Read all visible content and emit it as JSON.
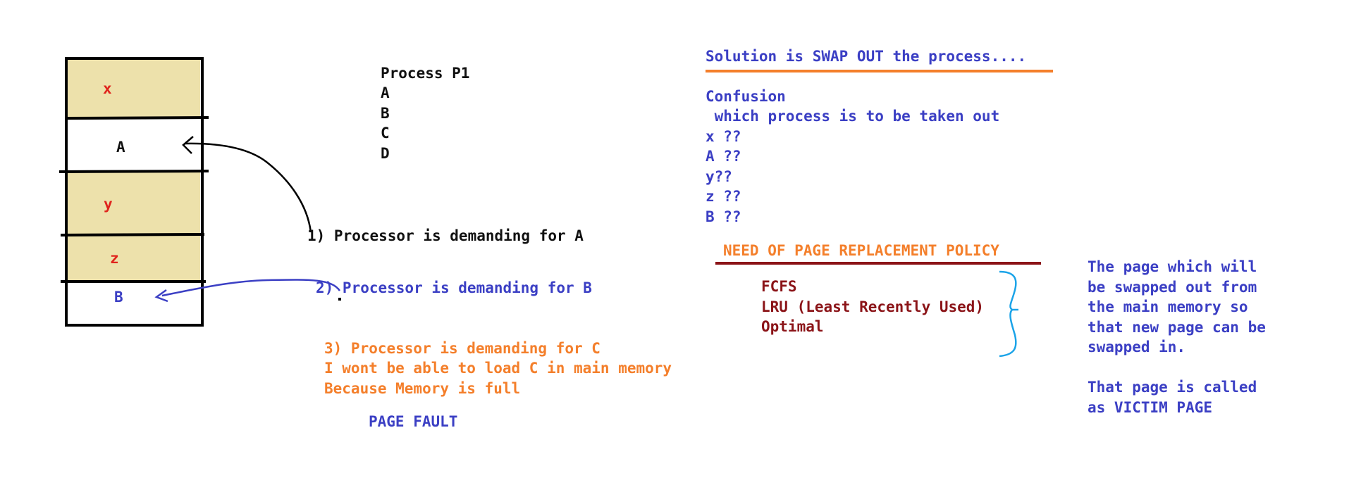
{
  "memory": {
    "frames": [
      {
        "label": "x",
        "filled": true
      },
      {
        "label": "A",
        "filled": false
      },
      {
        "label": "y",
        "filled": true
      },
      {
        "label": "z",
        "filled": true
      },
      {
        "label": "B",
        "filled": false
      }
    ]
  },
  "process": {
    "title": "Process P1",
    "pages": [
      "A",
      "B",
      "C",
      "D"
    ]
  },
  "steps": {
    "step1": "1) Processor is demanding for A",
    "step2": "2) Processor is demanding for B",
    "step3_lines": [
      "3) Processor is demanding for C",
      "I wont be able to load C in main memory",
      "Because Memory is full"
    ],
    "page_fault": "PAGE FAULT"
  },
  "solution": {
    "heading": "Solution is SWAP OUT the process....",
    "confusion_lines": [
      "Confusion",
      " which process is to be taken out",
      "x ??",
      "A ??",
      "y??",
      "z ??",
      "B ??"
    ]
  },
  "policy": {
    "heading": "NEED OF PAGE REPLACEMENT POLICY",
    "items": [
      "FCFS",
      "LRU (Least Recently Used)",
      "Optimal"
    ]
  },
  "victim": {
    "lines": [
      "The page which will",
      "be swapped out from",
      "the main memory so",
      "that new page can be",
      "swapped in.",
      "",
      "That page is called",
      "as VICTIM PAGE"
    ]
  },
  "colors": {
    "filled_frame": "#ede1ab",
    "blue_text": "#3b3fc4",
    "orange_text": "#f47f2b",
    "maroon_text": "#8b1418",
    "frame_label": "#e0231c",
    "brace": "#1aa3e8"
  }
}
